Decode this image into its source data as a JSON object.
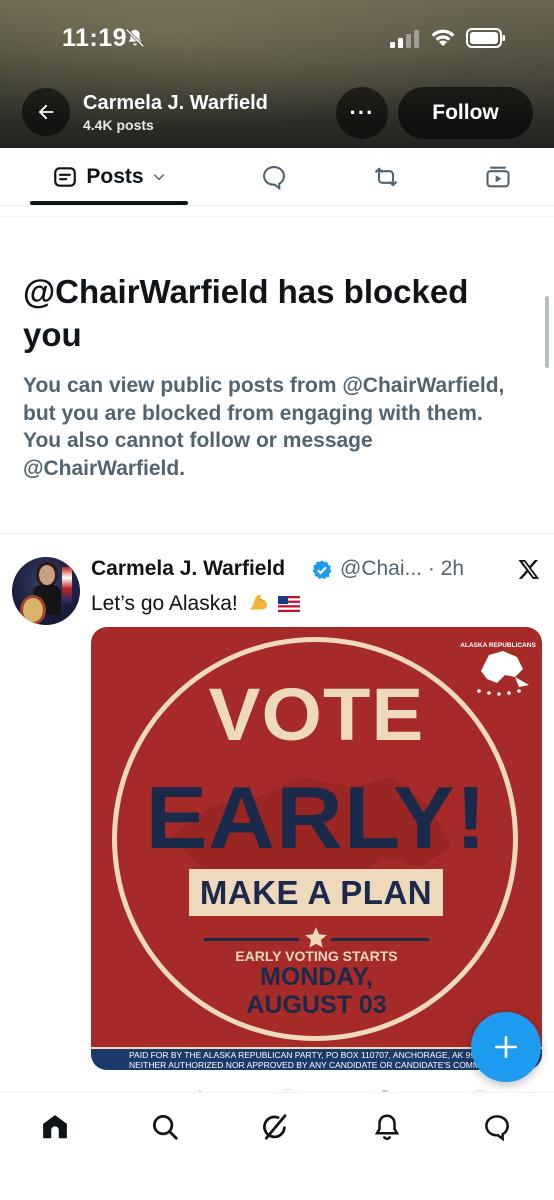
{
  "status_bar": {
    "time": "11:19"
  },
  "header": {
    "name": "Carmela J. Warfield",
    "post_count": "4.4K posts",
    "more_label": "···",
    "follow_label": "Follow"
  },
  "tabs": {
    "posts_label": "Posts",
    "items": [
      "posts",
      "replies",
      "reposts",
      "media"
    ]
  },
  "blocked": {
    "title": "@ChairWarfield has blocked you",
    "description": "You can view public posts from @ChairWarfield, but you are blocked from engaging with them. You also cannot follow or message @ChairWarfield."
  },
  "tweet": {
    "author_name": "Carmela J. Warfield",
    "handle_time": "@Chai... · 2h",
    "text": "Let’s go Alaska!",
    "emojis": [
      "flexed-biceps-icon",
      "us-flag-icon"
    ]
  },
  "poster": {
    "line_vote": "VOTE",
    "line_early": "EARLY!",
    "line_plan": "MAKE A PLAN",
    "line_starts": "EARLY VOTING STARTS",
    "line_day": "MONDAY,",
    "line_date": "AUGUST 03",
    "badge_text": "ALASKA REPUBLICANS",
    "footer_line1": "PAID FOR BY THE ALASKA REPUBLICAN PARTY, PO BOX 110707, ANCHORAGE, AK 99",
    "footer_line2": "NEITHER AUTHORIZED NOR APPROVED BY ANY CANDIDATE OR CANDIDATE'S COMMI",
    "colors": {
      "background": "#a52a28",
      "cream": "#efd9bd",
      "navy": "#1b2a4a"
    }
  },
  "bottom_nav": {
    "items": [
      "home-icon",
      "search-icon",
      "grok-icon",
      "notifications-icon",
      "messages-icon"
    ]
  },
  "colors": {
    "accent": "#1d9bf0",
    "text_primary": "#0f1419",
    "text_secondary": "#536471"
  }
}
